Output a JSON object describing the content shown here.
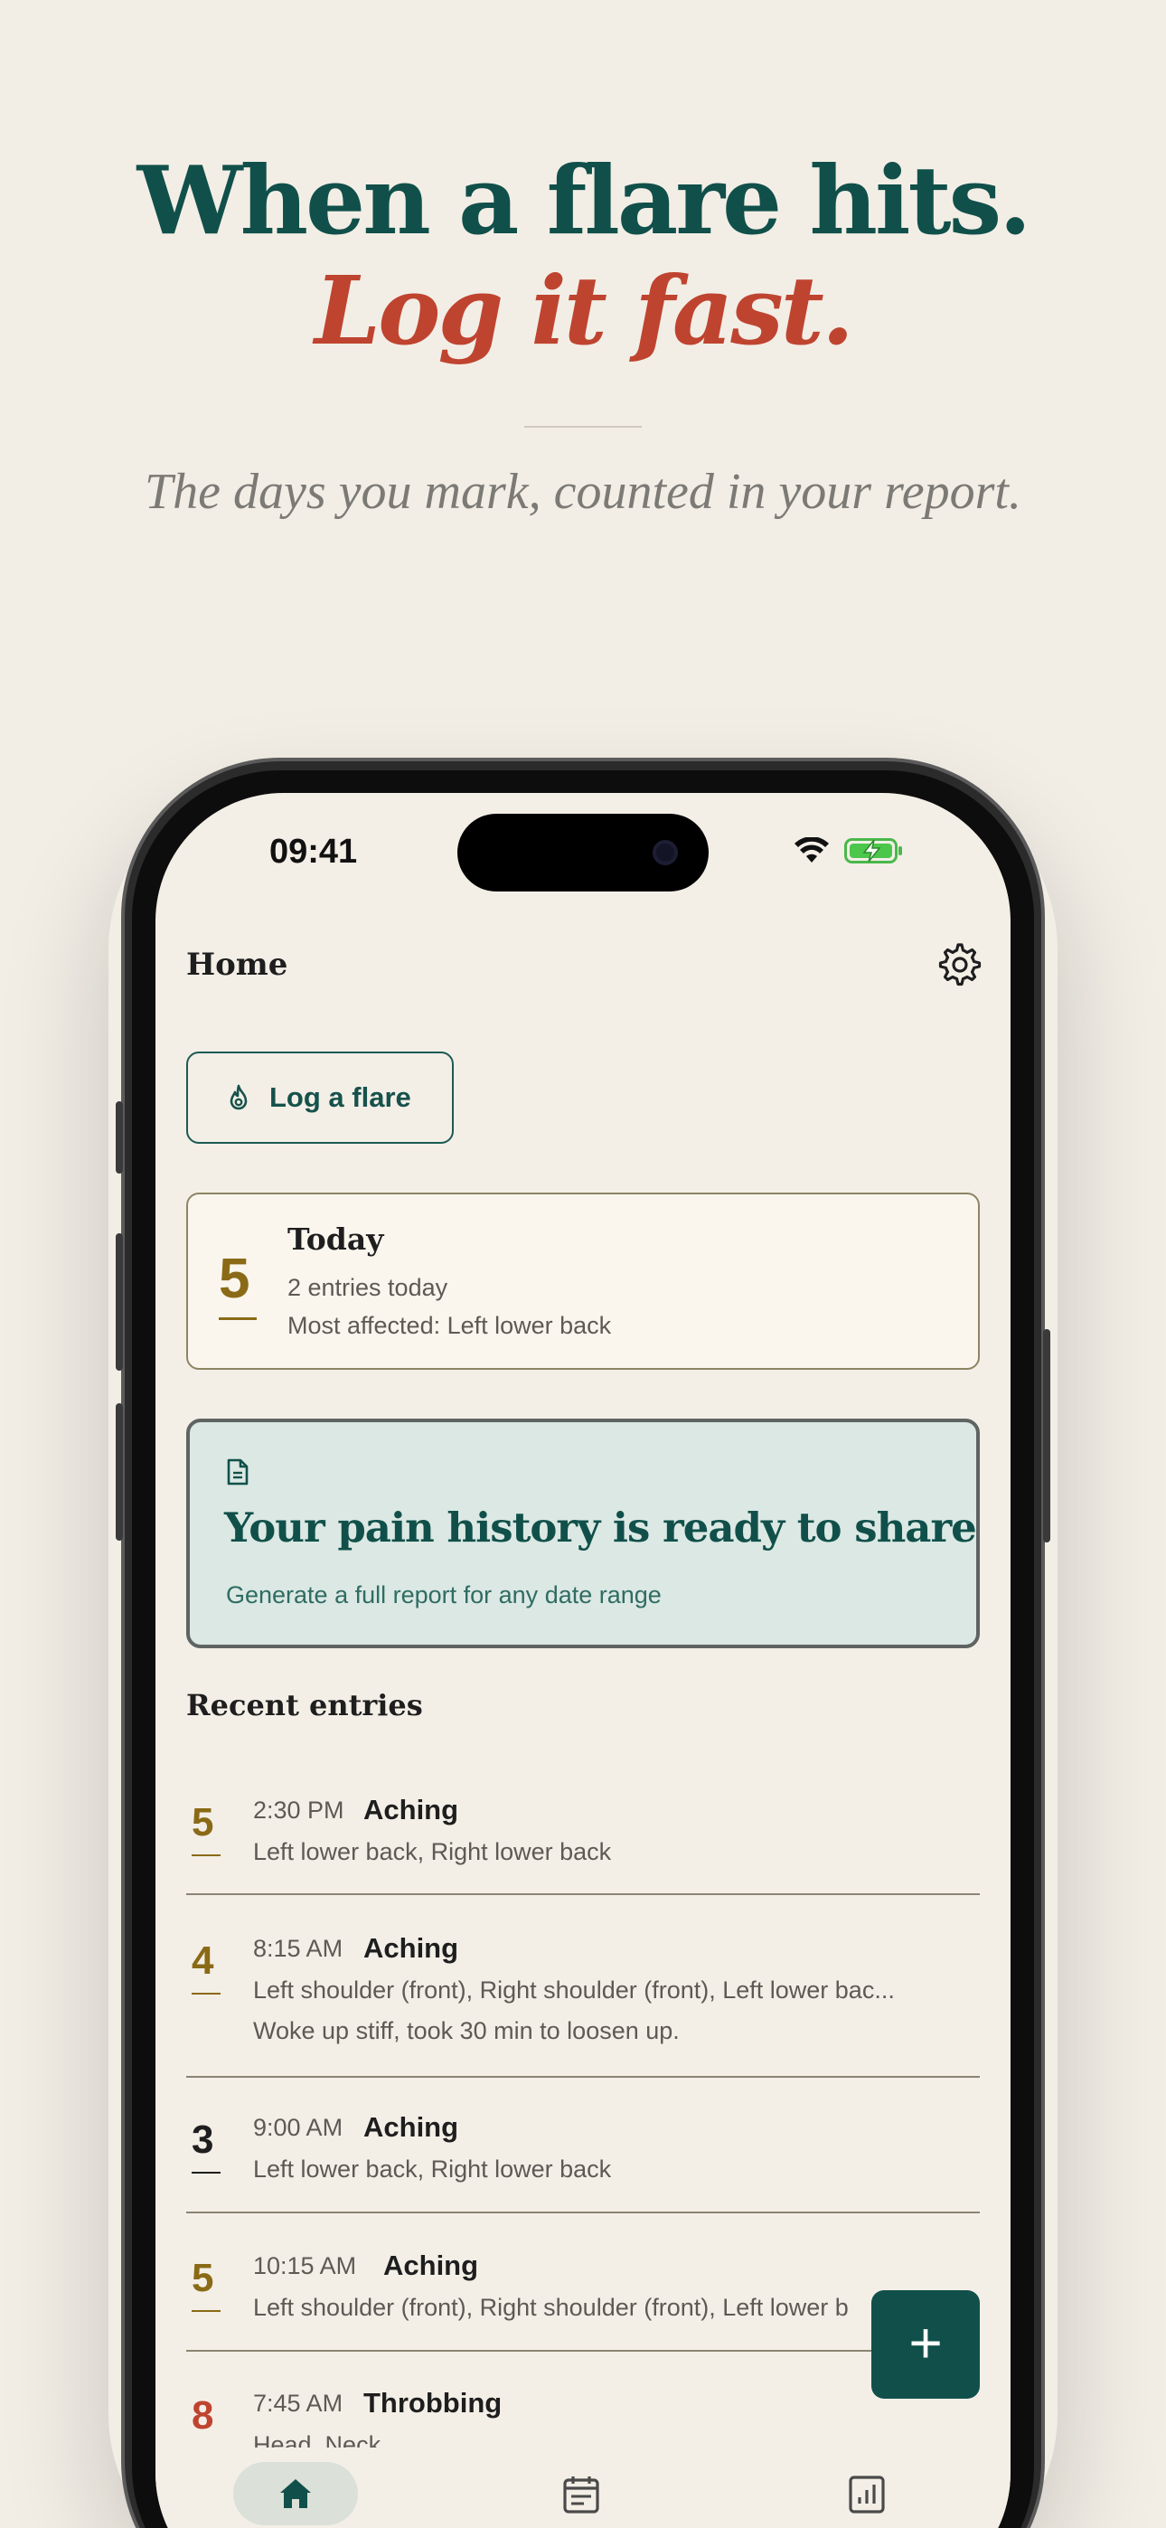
{
  "hero": {
    "headline": "When a flare hits.",
    "headline_accent": "Log it fast.",
    "subtitle": "The days you mark, counted in your report."
  },
  "status_bar": {
    "time": "09:41",
    "icons": [
      "wifi-icon",
      "battery-charging-icon"
    ]
  },
  "header": {
    "title": "Home",
    "settings_icon": "gear-icon"
  },
  "log_button": {
    "label": "Log a flare",
    "icon": "flame-icon"
  },
  "today_card": {
    "score": "5",
    "title": "Today",
    "entries": "2 entries today",
    "most_affected": "Most affected: Left lower back"
  },
  "share_card": {
    "icon": "document-icon",
    "title": "Your pain history is ready to share",
    "subtitle": "Generate a full report for any date range"
  },
  "recent": {
    "title": "Recent entries",
    "entries": [
      {
        "score": "5",
        "time": "2:30 PM",
        "type": "Aching",
        "areas": "Left lower back, Right lower back",
        "note": ""
      },
      {
        "score": "4",
        "time": "8:15 AM",
        "type": "Aching",
        "areas": "Left shoulder (front), Right shoulder (front), Left lower bac...",
        "note": "Woke up stiff, took 30 min to loosen up."
      },
      {
        "score": "3",
        "time": "9:00 AM",
        "type": "Aching",
        "areas": "Left lower back, Right lower back",
        "note": ""
      },
      {
        "score": "5",
        "time": "10:15 AM",
        "type": "Aching",
        "areas": "Left shoulder (front), Right shoulder (front), Left lower b",
        "note": ""
      },
      {
        "score": "8",
        "time": "7:45 AM",
        "type": "Throbbing",
        "areas": "Head, Neck",
        "note": ""
      }
    ]
  },
  "fab": {
    "label": "+"
  },
  "bottom_nav": {
    "items": [
      "home-icon",
      "calendar-icon",
      "report-chart-icon"
    ],
    "active": "home-icon"
  },
  "colors": {
    "primary": "#11504a",
    "accent": "#bf4430",
    "score_gold": "#8a6a16",
    "background": "#f3efe7"
  }
}
